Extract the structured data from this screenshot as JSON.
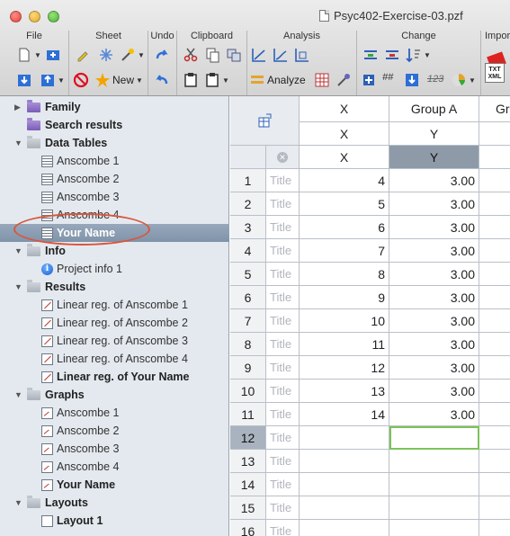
{
  "window": {
    "title": "Psyc402-Exercise-03.pzf"
  },
  "toolbar": {
    "groups": [
      "File",
      "Sheet",
      "Undo",
      "Clipboard",
      "Analysis",
      "Change",
      "Impor"
    ],
    "new_label": "New",
    "analyze_label": "Analyze",
    "txt_xml_label": "TXT XML",
    "num123": "123",
    "hash": "##"
  },
  "sidebar": {
    "family": "Family",
    "search_results": "Search results",
    "data_tables": "Data Tables",
    "data_items": [
      "Anscombe 1",
      "Anscombe 2",
      "Anscombe 3",
      "Anscombe 4",
      "Your Name"
    ],
    "info": "Info",
    "info_items": [
      "Project info 1"
    ],
    "results": "Results",
    "result_items": [
      "Linear reg. of Anscombe 1",
      "Linear reg. of Anscombe 2",
      "Linear reg. of Anscombe 3",
      "Linear reg. of Anscombe 4",
      "Linear reg. of Your Name"
    ],
    "graphs": "Graphs",
    "graph_items": [
      "Anscombe 1",
      "Anscombe 2",
      "Anscombe 3",
      "Anscombe 4",
      "Your Name"
    ],
    "layouts": "Layouts",
    "layout_items": [
      "Layout 1"
    ]
  },
  "sheet": {
    "col_x_header": "X",
    "col_a_header": "Group A",
    "col_next_header": "Gr",
    "x_sub": "X",
    "y_sub": "Y",
    "x_sub2": "X",
    "y_sub2": "Y",
    "title_placeholder": "Title",
    "rows": [
      {
        "n": "1",
        "x": "4",
        "y": "3.00"
      },
      {
        "n": "2",
        "x": "5",
        "y": "3.00"
      },
      {
        "n": "3",
        "x": "6",
        "y": "3.00"
      },
      {
        "n": "4",
        "x": "7",
        "y": "3.00"
      },
      {
        "n": "5",
        "x": "8",
        "y": "3.00"
      },
      {
        "n": "6",
        "x": "9",
        "y": "3.00"
      },
      {
        "n": "7",
        "x": "10",
        "y": "3.00"
      },
      {
        "n": "8",
        "x": "11",
        "y": "3.00"
      },
      {
        "n": "9",
        "x": "12",
        "y": "3.00"
      },
      {
        "n": "10",
        "x": "13",
        "y": "3.00"
      },
      {
        "n": "11",
        "x": "14",
        "y": "3.00"
      },
      {
        "n": "12",
        "x": "",
        "y": ""
      },
      {
        "n": "13",
        "x": "",
        "y": ""
      },
      {
        "n": "14",
        "x": "",
        "y": ""
      },
      {
        "n": "15",
        "x": "",
        "y": ""
      },
      {
        "n": "16",
        "x": "",
        "y": ""
      }
    ],
    "active_row": "12"
  },
  "colors": {
    "selection": "#7f93aa",
    "oval": "#d9563d",
    "sidebar_bg": "#e4e9ef",
    "y_header": "#8e9aa7",
    "active_cell_border": "#7cc35a"
  }
}
